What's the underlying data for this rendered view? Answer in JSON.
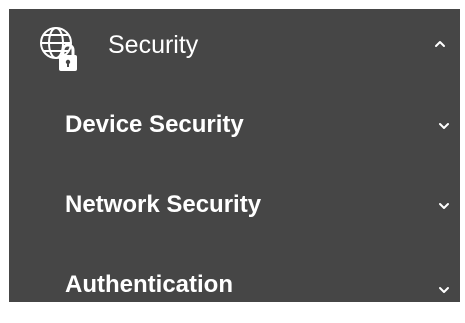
{
  "menu": {
    "title": "Security",
    "icon": "globe-lock-icon",
    "expanded_icon": "chevron-up-icon",
    "colors": {
      "background": "#464646",
      "text": "#ffffff"
    },
    "items": [
      {
        "label": "Device Security",
        "icon": "chevron-down-icon"
      },
      {
        "label": "Network Security",
        "icon": "chevron-down-icon"
      },
      {
        "label": "Authentication",
        "icon": "chevron-down-icon"
      }
    ]
  }
}
